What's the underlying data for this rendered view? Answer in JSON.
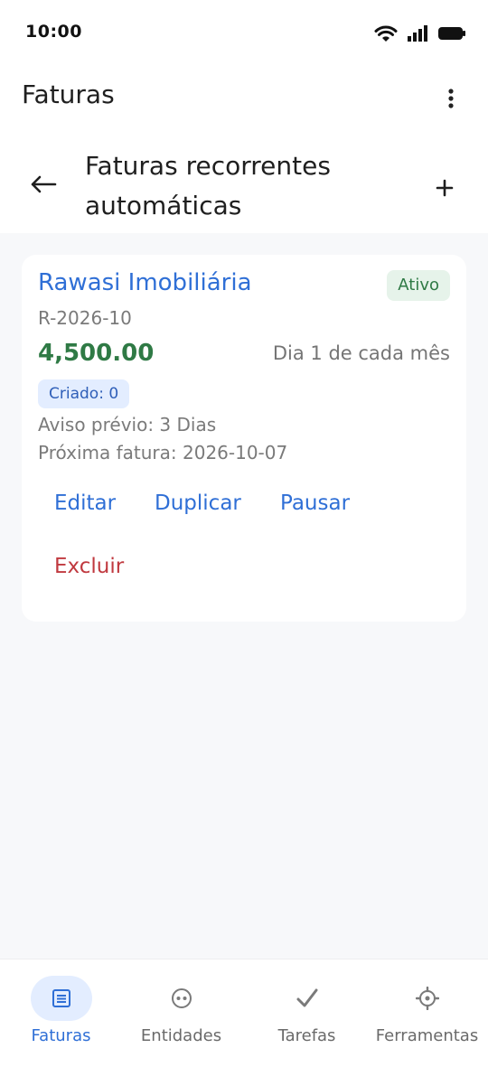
{
  "status_bar": {
    "time": "10:00"
  },
  "app_bar": {
    "title": "Faturas"
  },
  "sub_header": {
    "title": "Faturas recorrentes automáticas"
  },
  "invoice_card": {
    "client_name": "Rawasi Imobiliária",
    "status": "Ativo",
    "reference": "R-2026-10",
    "amount": "4,500.00",
    "schedule": "Dia 1 de cada mês",
    "created": "Criado: 0",
    "advance_notice": "Aviso prévio: 3 Dias",
    "next_invoice": "Próxima fatura: 2026-10-07",
    "actions": {
      "edit": "Editar",
      "duplicate": "Duplicar",
      "pause": "Pausar",
      "delete": "Excluir"
    }
  },
  "bottom_nav": {
    "items": [
      {
        "label": "Faturas",
        "icon": "invoice-list-icon",
        "active": true
      },
      {
        "label": "Entidades",
        "icon": "entities-icon",
        "active": false
      },
      {
        "label": "Tarefas",
        "icon": "check-icon",
        "active": false
      },
      {
        "label": "Ferramentas",
        "icon": "gear-icon",
        "active": false
      }
    ]
  },
  "colors": {
    "accent": "#2f6fd6",
    "success": "#2f7a45",
    "danger": "#c0393f",
    "background": "#f7f8fa"
  }
}
